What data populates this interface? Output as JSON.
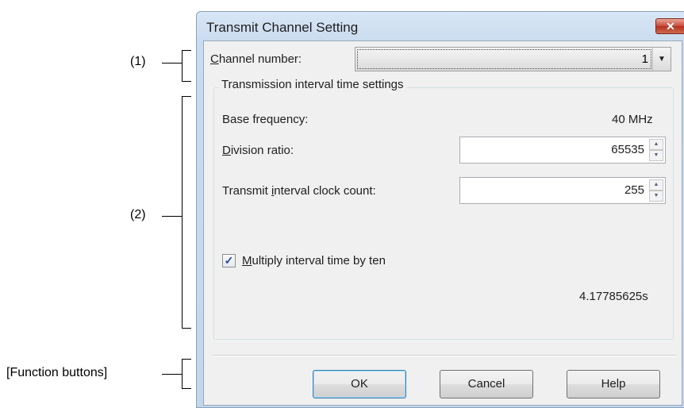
{
  "annotations": {
    "label_1": "(1)",
    "label_2": "(2)",
    "label_3": "[Function buttons]"
  },
  "dialog": {
    "title": "Transmit Channel Setting",
    "close_glyph": "✕",
    "channel_number": {
      "label_mnemonic": "C",
      "label_rest": "hannel number:",
      "value": "1",
      "arrow_glyph": "▼"
    },
    "group": {
      "title": "Transmission interval time settings",
      "base_frequency_label": "Base frequency:",
      "base_frequency_value": "40 MHz",
      "division_ratio": {
        "label_mnemonic": "D",
        "label_rest": "ivision ratio:",
        "value": "65535"
      },
      "clock_count": {
        "label_before": "Transmit ",
        "label_mnemonic": "i",
        "label_after": "nterval clock count:",
        "value": "255"
      },
      "multiply": {
        "checked": true,
        "check_glyph": "✓",
        "label_mnemonic": "M",
        "label_rest": "ultiply interval time by ten"
      },
      "result": "4.17785625s"
    },
    "buttons": {
      "ok": "OK",
      "cancel": "Cancel",
      "help_mnemonic": "H",
      "help_rest": "elp"
    }
  },
  "icons": {
    "spin_up": "▲",
    "spin_down": "▼"
  },
  "colors": {
    "close_button": "#c8493a",
    "titlebar": "#c9dbef",
    "client_bg": "#f0f0f0",
    "default_button_border": "#3c7fb1"
  }
}
